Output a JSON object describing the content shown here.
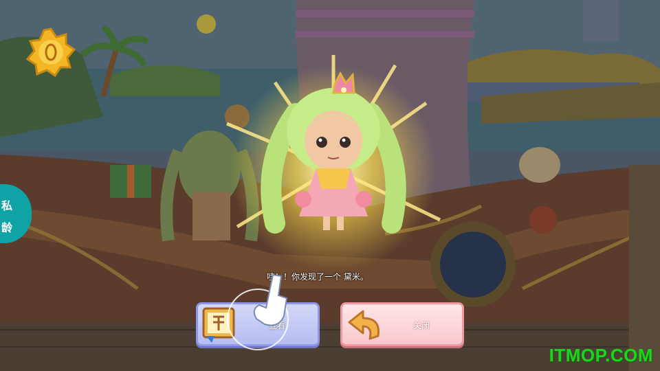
{
  "hud": {
    "badge_icon": "gold-star-badge-icon",
    "side_tab_chars": [
      "私",
      "龄"
    ]
  },
  "dialog": {
    "message": "哇！！你发现了一个 黛米。",
    "view_button_label": "查看",
    "close_button_label": "关闭",
    "view_icon": "treasure-book-icon",
    "close_icon": "return-arrow-icon"
  },
  "watermark": "ITMOP.COM",
  "colors": {
    "teal_tab": "#0fa3a6",
    "view_button": "#b6bdf1",
    "close_button": "#f9c8cc",
    "watermark": "#1fd31f"
  }
}
